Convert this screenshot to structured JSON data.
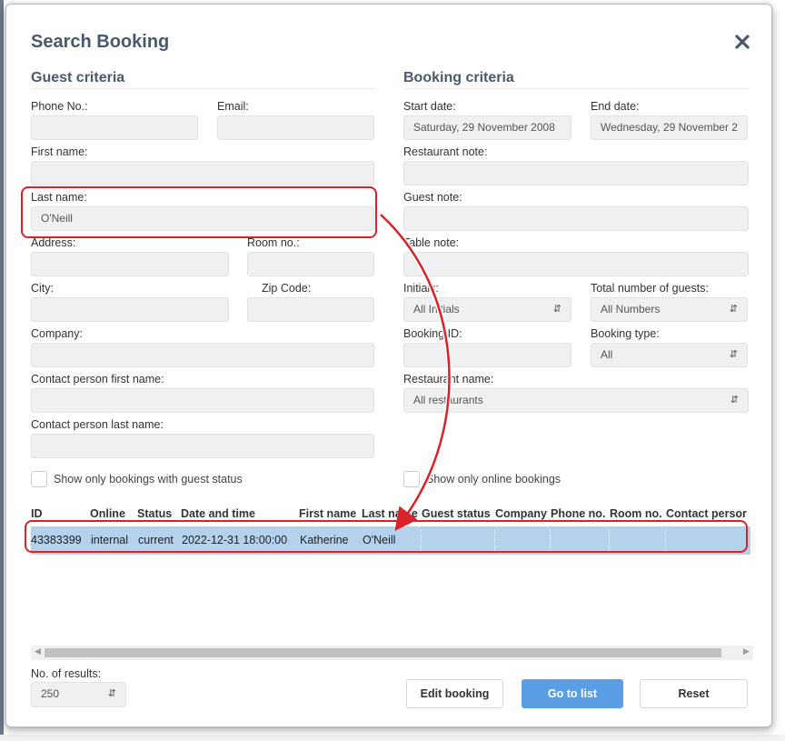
{
  "dialog": {
    "title": "Search Booking",
    "close_icon": "close-icon"
  },
  "guest_criteria": {
    "title": "Guest criteria",
    "phone_label": "Phone No.:",
    "phone_value": "",
    "email_label": "Email:",
    "email_value": "",
    "first_name_label": "First name:",
    "first_name_value": "",
    "last_name_label": "Last name:",
    "last_name_value": "O'Neill",
    "address_label": "Address:",
    "address_value": "",
    "room_label": "Room no.:",
    "room_value": "",
    "city_label": "City:",
    "city_value": "",
    "zip_label": "Zip Code:",
    "zip_value": "",
    "company_label": "Company:",
    "company_value": "",
    "contact_first_label": "Contact person first name:",
    "contact_first_value": "",
    "contact_last_label": "Contact person last name:",
    "contact_last_value": "",
    "guest_status_checkbox": "Show only bookings with guest status"
  },
  "booking_criteria": {
    "title": "Booking criteria",
    "start_label": "Start date:",
    "start_value": "Saturday, 29 November 2008",
    "end_label": "End date:",
    "end_value": "Wednesday, 29 November 2",
    "restaurant_note_label": "Restaurant note:",
    "restaurant_note_value": "",
    "guest_note_label": "Guest note:",
    "guest_note_value": "",
    "table_note_label": "Table note:",
    "table_note_value": "",
    "initials_label": "Initials:",
    "initials_value": "All Initials",
    "total_guests_label": "Total number of guests:",
    "total_guests_value": "All Numbers",
    "booking_id_label": "Booking ID:",
    "booking_id_value": "",
    "booking_type_label": "Booking type:",
    "booking_type_value": "All",
    "restaurant_name_label": "Restaurant name:",
    "restaurant_name_value": "All restaurants",
    "online_checkbox": "Show only online bookings"
  },
  "results_table": {
    "columns": [
      "ID",
      "Online",
      "Status",
      "Date and time",
      "First name",
      "Last name",
      "Guest status",
      "Company",
      "Phone no.",
      "Room no.",
      "Contact persor"
    ],
    "rows": [
      [
        "43383399",
        "internal",
        "current",
        "2022-12-31 18:00:00",
        "Katherine",
        "O'Neill",
        "",
        "",
        "",
        "",
        ""
      ]
    ]
  },
  "footer": {
    "results_label": "No. of results:",
    "results_value": "250",
    "edit_button": "Edit booking",
    "go_to_list_button": "Go to list",
    "reset_button": "Reset"
  },
  "colors": {
    "title": "#4a5a6e",
    "selected_row": "#b5d2ed",
    "primary_button": "#5a9fe6",
    "highlight": "#d8232a"
  }
}
